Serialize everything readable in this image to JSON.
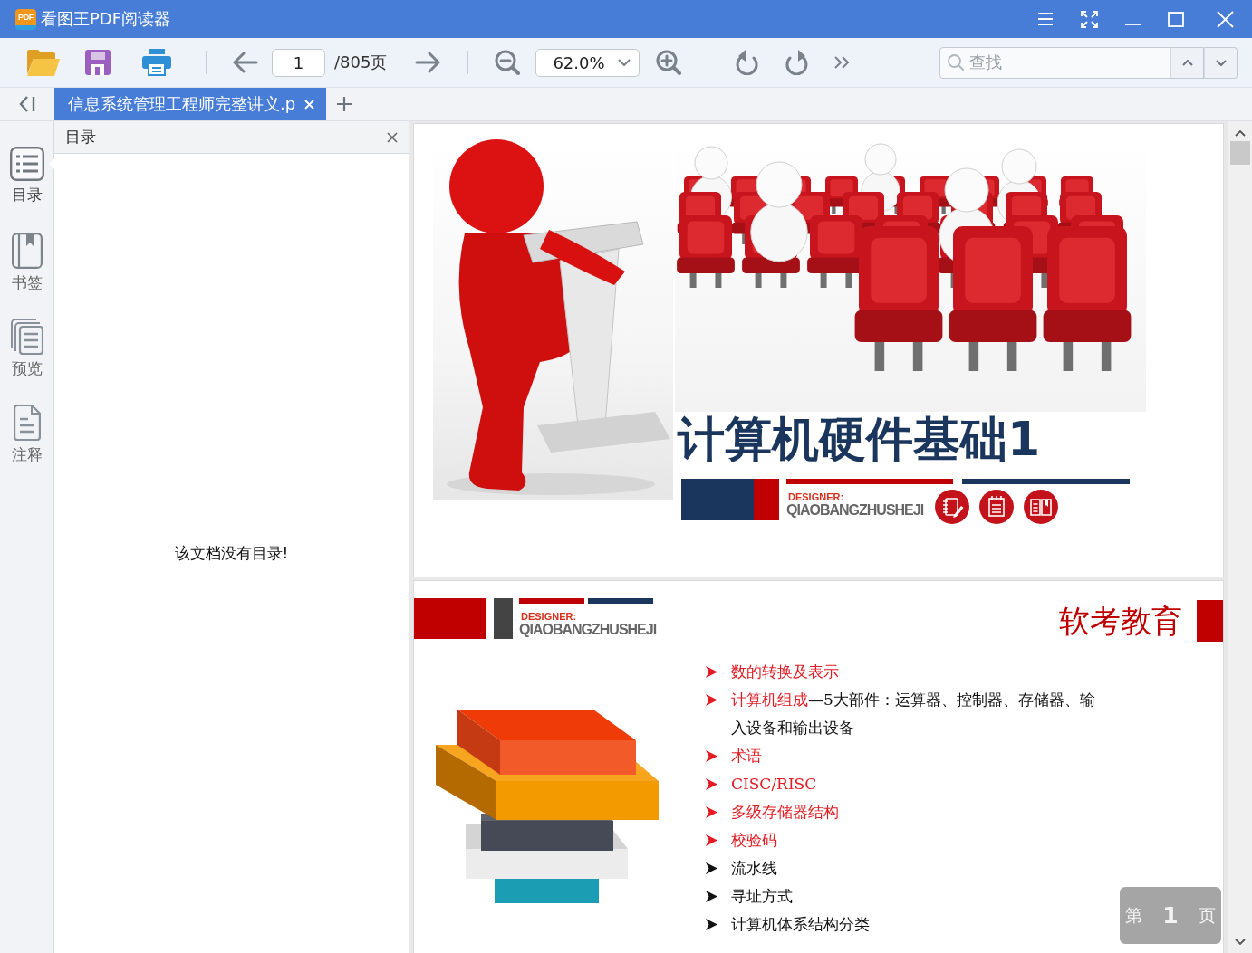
{
  "window": {
    "logo_text": "PDF",
    "title": "看图王PDF阅读器"
  },
  "toolbar": {
    "page_field": {
      "value": "1"
    },
    "page_total": "/805页",
    "zoom": {
      "value": "62.0%"
    },
    "search": {
      "placeholder": "查找"
    }
  },
  "tabs": [
    {
      "label": "信息系统管理工程师完整讲义.p",
      "selected": true
    }
  ],
  "sidebar": {
    "items": [
      {
        "kind": "toc",
        "label": "目录",
        "selected": true
      },
      {
        "kind": "bookmarks",
        "label": "书签",
        "selected": false
      },
      {
        "kind": "preview",
        "label": "预览",
        "selected": false
      },
      {
        "kind": "annotations",
        "label": "注释",
        "selected": false
      }
    ]
  },
  "toc_panel": {
    "title": "目录",
    "message": "该文档没有目录!"
  },
  "pages": [
    {
      "kind": "cover",
      "title": "计算机硬件基础1",
      "designer_label": "DESIGNER:",
      "designer_name": "QIAOBANGZHUSHEJI"
    },
    {
      "kind": "outline",
      "designer_label": "DESIGNER:",
      "designer_name": "QIAOBANGZHUSHEJI",
      "heading": "软考教育",
      "items": [
        {
          "emphasis": "数的转换及表示"
        },
        {
          "emphasis": "计算机组成",
          "text": "—5大部件：运算器、控制器、存储器、输入设备和输出设备"
        },
        {
          "emphasis": "术语"
        },
        {
          "emphasis": "CISC/RISC"
        },
        {
          "emphasis": "多级存储器结构"
        },
        {
          "emphasis": "校验码"
        },
        {
          "text": "流水线"
        },
        {
          "text": "寻址方式"
        },
        {
          "text": "计算机体系结构分类"
        }
      ]
    }
  ],
  "page_indicator": "第 **1** 页"
}
